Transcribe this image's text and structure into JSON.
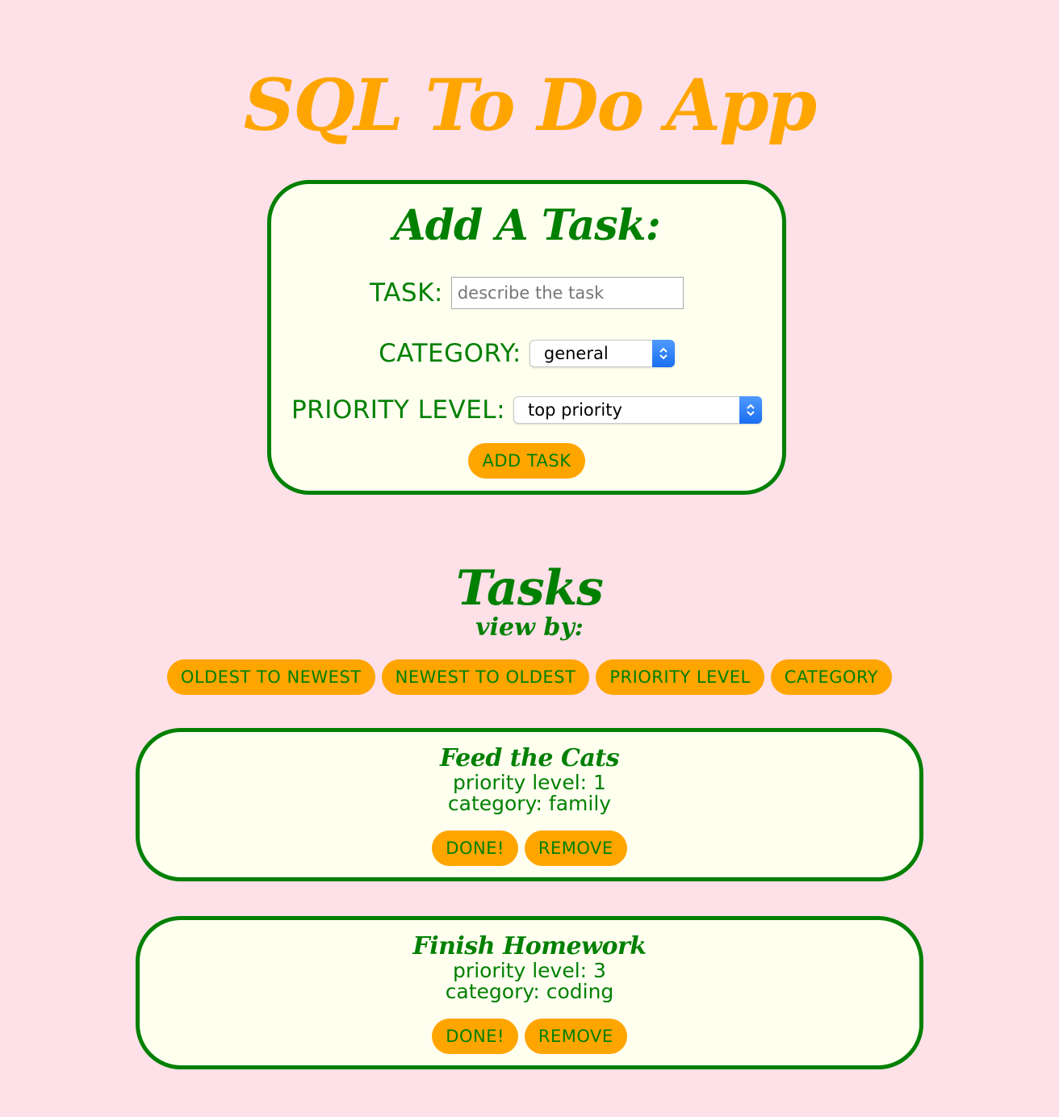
{
  "app": {
    "title": "SQL To Do App"
  },
  "add_form": {
    "title": "Add A Task:",
    "task_label": "TASK:",
    "task_placeholder": "describe the task",
    "task_value": "",
    "category_label": "CATEGORY:",
    "category_selected": "general",
    "priority_label": "PRIORITY LEVEL:",
    "priority_selected": "top priority",
    "submit_label": "ADD TASK"
  },
  "tasks_section": {
    "title": "Tasks",
    "view_by_label": "view by:",
    "sort_buttons": [
      "OLDEST TO NEWEST",
      "NEWEST TO OLDEST",
      "PRIORITY LEVEL",
      "CATEGORY"
    ]
  },
  "tasks": [
    {
      "name": "Feed the Cats",
      "priority_text": "priority level: 1",
      "category_text": "category: family",
      "done_label": "DONE!",
      "remove_label": "REMOVE"
    },
    {
      "name": "Finish Homework",
      "priority_text": "priority level: 3",
      "category_text": "category: coding",
      "done_label": "DONE!",
      "remove_label": "REMOVE"
    }
  ],
  "colors": {
    "background": "#fde0e8",
    "accent_orange": "#ffa500",
    "text_green": "#008000",
    "card_background": "#fffff0",
    "select_arrow_blue": "#1a6ef0"
  },
  "icons": {
    "select_arrow": "chevron-up-down-icon"
  }
}
